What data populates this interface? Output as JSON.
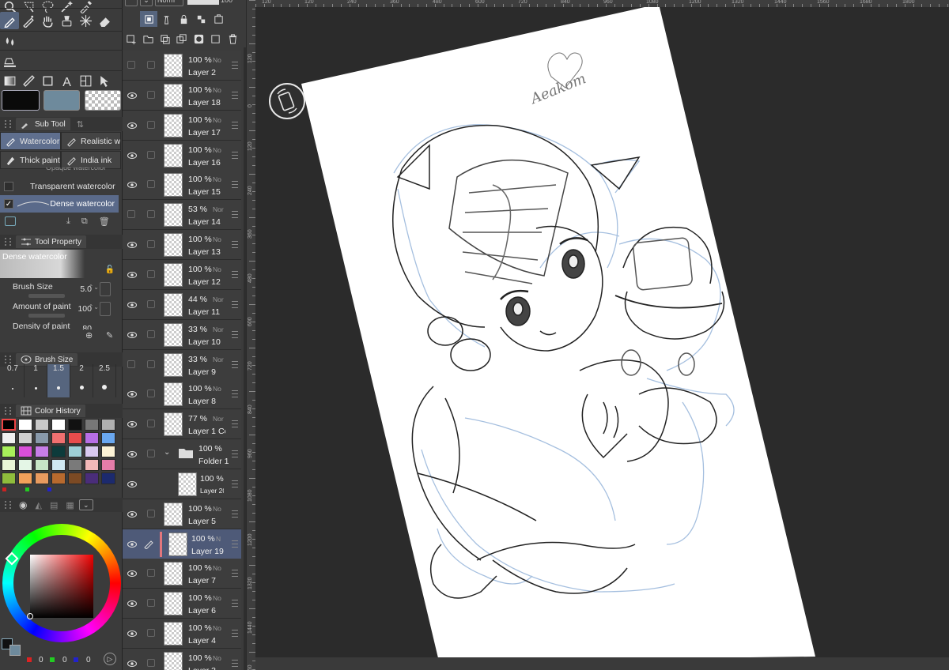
{
  "colors": {
    "panel_bg": "#3b3b3b",
    "canvas_bg": "#2b2b2b",
    "active_blue": "#56657e",
    "selected_layer": "#4e5a78",
    "main_color": "#0a0a0a",
    "sub_color": "#6e8a9c"
  },
  "top_header": {
    "blend_mode_short": "Norm",
    "opacity_short": "100"
  },
  "tool_icons": [
    [
      "zoom-icon",
      "lasso-select-icon",
      "lasso-icon",
      "magic-wand-icon",
      "eyedropper-icon"
    ],
    [
      "pen-icon",
      "pencil-icon",
      "hand-icon",
      "brush-icon",
      "decoration-icon",
      "eraser-icon"
    ],
    [
      "blend-icon",
      "",
      ""
    ],
    [
      "fill-icon"
    ],
    [
      "gradient-icon",
      "ruler-icon",
      "rectangle-icon",
      "text-icon",
      "frame-icon",
      "operation-icon"
    ]
  ],
  "sub_tool": {
    "panel_label": "Sub Tool",
    "groups": [
      "Watercolor",
      "Realistic w",
      "Thick paint",
      "India ink"
    ],
    "hidden_partial": "Opaque watercolor",
    "items": [
      {
        "label": "Transparent watercolor",
        "checked": false
      },
      {
        "label": "Dense watercolor",
        "checked": true
      }
    ]
  },
  "tool_property": {
    "panel_label": "Tool Property",
    "brush_name": "Dense watercolor",
    "rows": [
      {
        "label": "Brush Size",
        "value": "5.0"
      },
      {
        "label": "Amount of paint",
        "value": "100"
      },
      {
        "label": "Density of paint",
        "value": "80"
      }
    ]
  },
  "brush_size": {
    "panel_label": "Brush Size",
    "sizes": [
      "0.7",
      "1",
      "1.5",
      "2",
      "2.5"
    ],
    "active_index": 2
  },
  "color_history": {
    "panel_label": "Color History",
    "rows": [
      [
        "#000000",
        "#ffffff",
        "#c8c8c8",
        "#ffffff",
        "#111111",
        "#777777",
        "#b0b0b0"
      ],
      [
        "#f0f0f0",
        "#d0d0d0",
        "#8899aa",
        "#f07070",
        "#e84c4c",
        "#b76ee6",
        "#6aa8f0"
      ],
      [
        "#a8ef5a",
        "#d94fd9",
        "#c77ee8",
        "#0d3b3b",
        "#9ecfd6",
        "#d8c9f0",
        "#fdf3d6"
      ],
      [
        "#eaf6d6",
        "#e4f6e6",
        "#c7e6c7",
        "#d0e8f2",
        "#7a7a7a",
        "#f3b8b8",
        "#e57ca9"
      ],
      [
        "#8fbd3c",
        "#f2a15a",
        "#e89b5f",
        "#b86a2e",
        "#7c4a24",
        "#4a2d7a",
        "#1c2a6e"
      ]
    ]
  },
  "color_wheel": {
    "rgb_r": "0",
    "rgb_g": "0",
    "rgb_b": "0"
  },
  "layers": [
    {
      "opacity": "100 %",
      "mode": "No",
      "name": "Layer 2",
      "visible": false
    },
    {
      "opacity": "100 %",
      "mode": "No",
      "name": "Layer 18",
      "visible": true
    },
    {
      "opacity": "100 %",
      "mode": "No",
      "name": "Layer 17",
      "visible": true
    },
    {
      "opacity": "100 %",
      "mode": "No",
      "name": "Layer 16",
      "visible": true
    },
    {
      "opacity": "100 %",
      "mode": "No",
      "name": "Layer 15",
      "visible": true
    },
    {
      "opacity": "53 %",
      "mode": "Norm",
      "name": "Layer 14",
      "visible": false
    },
    {
      "opacity": "100 %",
      "mode": "No",
      "name": "Layer 13",
      "visible": true
    },
    {
      "opacity": "100 %",
      "mode": "No",
      "name": "Layer 12",
      "visible": true
    },
    {
      "opacity": "44 %",
      "mode": "Norm",
      "name": "Layer 11",
      "visible": true
    },
    {
      "opacity": "33 %",
      "mode": "Norm",
      "name": "Layer 10",
      "visible": true
    },
    {
      "opacity": "33 %",
      "mode": "Norm",
      "name": "Layer 9",
      "visible": false
    },
    {
      "opacity": "100 %",
      "mode": "No",
      "name": "Layer 8",
      "visible": true
    },
    {
      "opacity": "77 %",
      "mode": "Norm",
      "name": "Layer 1 Copy",
      "visible": true
    },
    {
      "opacity": "100 %",
      "mode": "",
      "name": "Folder 1",
      "visible": true,
      "folder": true
    },
    {
      "opacity": "100 %",
      "mode": "",
      "name": "Layer 20",
      "visible": true,
      "child": true
    },
    {
      "opacity": "100 %",
      "mode": "No",
      "name": "Layer 5",
      "visible": true
    },
    {
      "opacity": "100 %",
      "mode": "N",
      "name": "Layer 19",
      "visible": true,
      "selected": true
    },
    {
      "opacity": "100 %",
      "mode": "No",
      "name": "Layer 7",
      "visible": true
    },
    {
      "opacity": "100 %",
      "mode": "No",
      "name": "Layer 6",
      "visible": true
    },
    {
      "opacity": "100 %",
      "mode": "No",
      "name": "Layer 4",
      "visible": true
    },
    {
      "opacity": "100 %",
      "mode": "No",
      "name": "Layer 3",
      "visible": true
    }
  ],
  "ruler": {
    "vertical": [
      "120",
      "0",
      "120",
      "240",
      "360",
      "480",
      "600",
      "720",
      "840",
      "960",
      "1080",
      "1200",
      "1320",
      "1440",
      "1560"
    ],
    "horizontal": [
      "120",
      "120",
      "240",
      "360",
      "480",
      "600",
      "720",
      "840",
      "960",
      "1080",
      "1200",
      "1320",
      "1440",
      "1560",
      "1680",
      "1800"
    ]
  },
  "canvas": {
    "signature": "Aeakom",
    "rotate_button": "rotate-canvas-button"
  }
}
